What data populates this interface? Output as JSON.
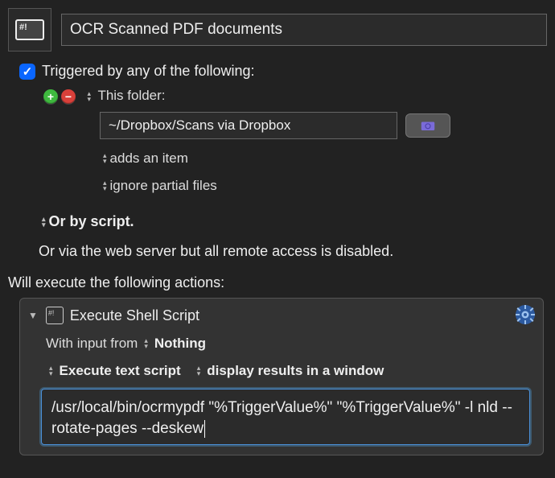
{
  "macro": {
    "name": "OCR Scanned PDF documents"
  },
  "trigger": {
    "enabled_label": "Triggered by any of the following:",
    "folder_label": "This folder:",
    "folder_path": "~/Dropbox/Scans via Dropbox",
    "event": "adds an item",
    "partial": "ignore partial files",
    "or_script": "Or by script.",
    "web_line": "Or via the web server but all remote access is disabled."
  },
  "actions_header": "Will execute the following actions:",
  "action": {
    "title": "Execute Shell Script",
    "input_label": "With input from",
    "input_value": "Nothing",
    "mode": "Execute text script",
    "display": "display results in a window",
    "script": "/usr/local/bin/ocrmypdf \"%TriggerValue%\" \"%TriggerValue%\" -l nld --rotate-pages --deskew"
  }
}
